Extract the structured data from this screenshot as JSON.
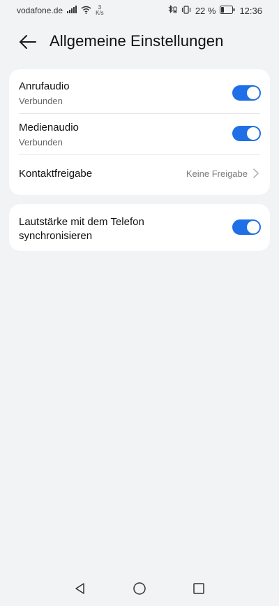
{
  "status_bar": {
    "carrier": "vodafone.de",
    "net_speed_value": "3",
    "net_speed_unit": "K/s",
    "battery_percent": "22 %",
    "time": "12:36"
  },
  "header": {
    "title": "Allgemeine Einstellungen"
  },
  "settings": {
    "call_audio": {
      "title": "Anrufaudio",
      "subtitle": "Verbunden",
      "enabled": true
    },
    "media_audio": {
      "title": "Medienaudio",
      "subtitle": "Verbunden",
      "enabled": true
    },
    "contact_sharing": {
      "title": "Kontaktfreigabe",
      "value": "Keine Freigabe"
    },
    "volume_sync": {
      "title": "Lautstärke mit dem Telefon synchronisieren",
      "enabled": true
    }
  },
  "colors": {
    "accent": "#1f6fe6",
    "background": "#f1f3f5",
    "card": "#ffffff"
  },
  "icons": {
    "back": "arrow-left-icon",
    "chevron": "chevron-right-icon",
    "nav_back": "triangle-back-icon",
    "nav_home": "circle-home-icon",
    "nav_recents": "square-recents-icon"
  }
}
